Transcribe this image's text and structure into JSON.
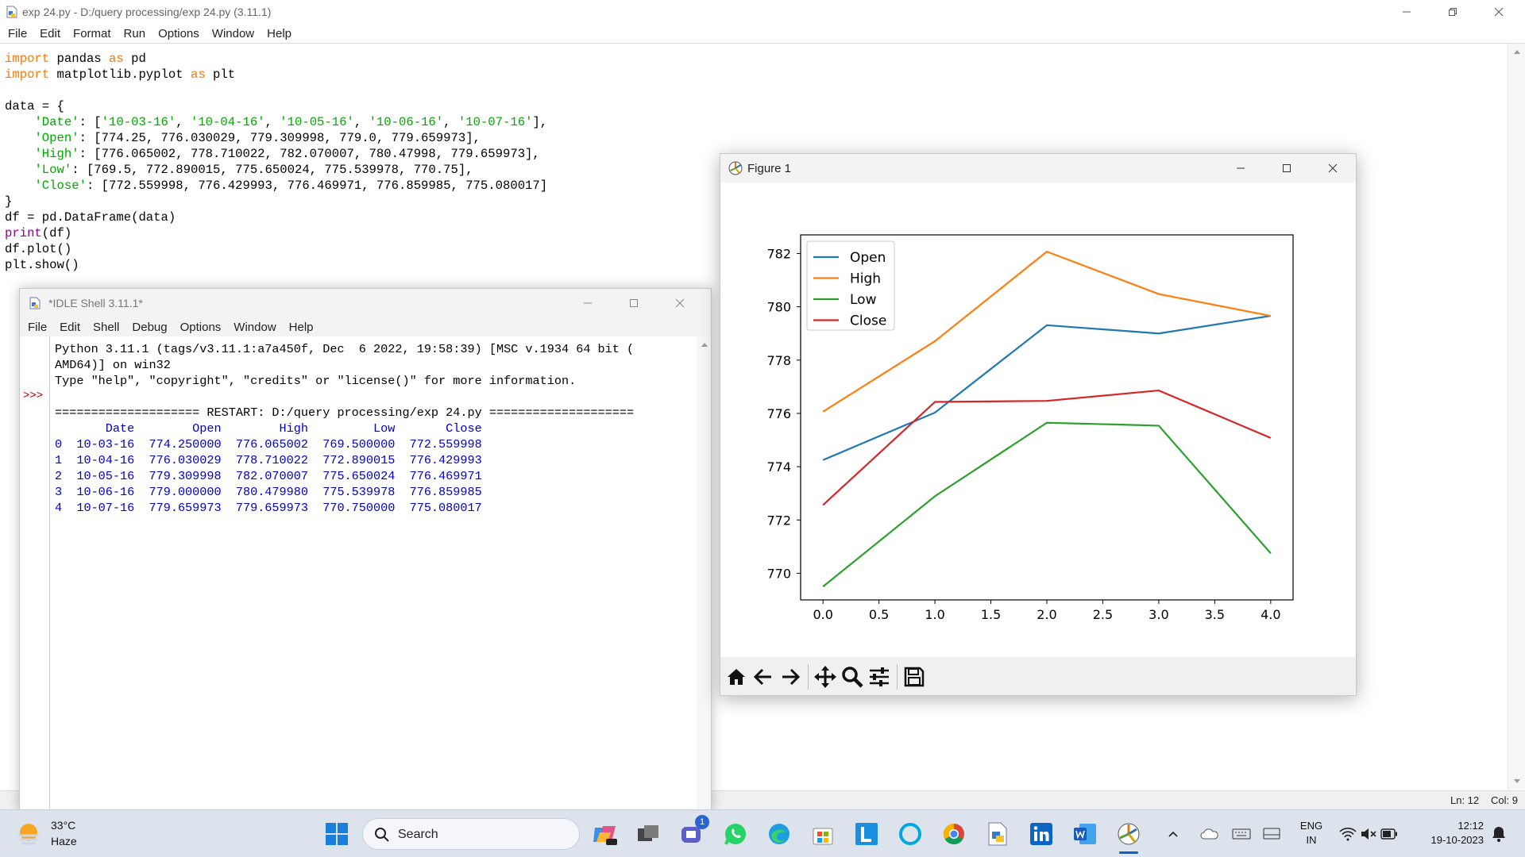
{
  "editor": {
    "title": "exp 24.py - D:/query processing/exp 24.py (3.11.1)",
    "menu": [
      "File",
      "Edit",
      "Format",
      "Run",
      "Options",
      "Window",
      "Help"
    ],
    "status": {
      "line": "Ln: 12",
      "col": "Col: 9"
    }
  },
  "code_lines": [
    [
      [
        "kw",
        "import"
      ],
      [
        "",
        " pandas "
      ],
      [
        "kw",
        "as"
      ],
      [
        "",
        " pd"
      ]
    ],
    [
      [
        "kw",
        "import"
      ],
      [
        "",
        " matplotlib.pyplot "
      ],
      [
        "kw",
        "as"
      ],
      [
        "",
        " plt"
      ]
    ],
    [],
    [
      [
        "",
        "data = {"
      ]
    ],
    [
      [
        "",
        "    "
      ],
      [
        "str",
        "'Date'"
      ],
      [
        "",
        ": ["
      ],
      [
        "str",
        "'10-03-16'"
      ],
      [
        "",
        ", "
      ],
      [
        "str",
        "'10-04-16'"
      ],
      [
        "",
        ", "
      ],
      [
        "str",
        "'10-05-16'"
      ],
      [
        "",
        ", "
      ],
      [
        "str",
        "'10-06-16'"
      ],
      [
        "",
        ", "
      ],
      [
        "str",
        "'10-07-16'"
      ],
      [
        "",
        "],"
      ]
    ],
    [
      [
        "",
        "    "
      ],
      [
        "str",
        "'Open'"
      ],
      [
        "",
        ": [774.25, 776.030029, 779.309998, 779.0, 779.659973],"
      ]
    ],
    [
      [
        "",
        "    "
      ],
      [
        "str",
        "'High'"
      ],
      [
        "",
        ": [776.065002, 778.710022, 782.070007, 780.47998, 779.659973],"
      ]
    ],
    [
      [
        "",
        "    "
      ],
      [
        "str",
        "'Low'"
      ],
      [
        "",
        ": [769.5, 772.890015, 775.650024, 775.539978, 770.75],"
      ]
    ],
    [
      [
        "",
        "    "
      ],
      [
        "str",
        "'Close'"
      ],
      [
        "",
        ": [772.559998, 776.429993, 776.469971, 776.859985, 775.080017]"
      ]
    ],
    [
      [
        "",
        "}"
      ]
    ],
    [
      [
        "",
        "df = pd.DataFrame(data)"
      ]
    ],
    [
      [
        "bi",
        "print"
      ],
      [
        "",
        "(df)"
      ]
    ],
    [
      [
        "",
        "df.plot()"
      ]
    ],
    [
      [
        "",
        "plt.show()"
      ]
    ]
  ],
  "shell": {
    "title": "*IDLE Shell 3.11.1*",
    "menu": [
      "File",
      "Edit",
      "Shell",
      "Debug",
      "Options",
      "Window",
      "Help"
    ],
    "prompt": ">>>",
    "banner": [
      "Python 3.11.1 (tags/v3.11.1:a7a450f, Dec  6 2022, 19:58:39) [MSC v.1934 64 bit (",
      "AMD64)] on win32",
      "Type \"help\", \"copyright\", \"credits\" or \"license()\" for more information."
    ],
    "restart": "==================== RESTART: D:/query processing/exp 24.py ====================",
    "output": [
      "       Date        Open        High         Low       Close",
      "0  10-03-16  774.250000  776.065002  769.500000  772.559998",
      "1  10-04-16  776.030029  778.710022  772.890015  776.429993",
      "2  10-05-16  779.309998  782.070007  775.650024  776.469971",
      "3  10-06-16  779.000000  780.479980  775.539978  776.859985",
      "4  10-07-16  779.659973  779.659973  770.750000  775.080017"
    ]
  },
  "figure": {
    "title": "Figure 1",
    "toolbar": [
      "home-icon",
      "back-arrow-icon",
      "forward-arrow-icon",
      "pan-icon",
      "zoom-icon",
      "configure-subplots-icon",
      "save-icon"
    ]
  },
  "chart_data": {
    "type": "line",
    "x": [
      0,
      1,
      2,
      3,
      4
    ],
    "xticks": [
      "0.0",
      "0.5",
      "1.0",
      "1.5",
      "2.0",
      "2.5",
      "3.0",
      "3.5",
      "4.0"
    ],
    "yticks": [
      "770",
      "772",
      "774",
      "776",
      "778",
      "780",
      "782"
    ],
    "xlim": [
      -0.2,
      4.2
    ],
    "ylim": [
      769.0,
      782.7
    ],
    "legend_position": "upper left",
    "series": [
      {
        "name": "Open",
        "color": "#1f77b4",
        "values": [
          774.25,
          776.030029,
          779.309998,
          779.0,
          779.659973
        ]
      },
      {
        "name": "High",
        "color": "#ff7f0e",
        "values": [
          776.065002,
          778.710022,
          782.070007,
          780.47998,
          779.659973
        ]
      },
      {
        "name": "Low",
        "color": "#2ca02c",
        "values": [
          769.5,
          772.890015,
          775.650024,
          775.539978,
          770.75
        ]
      },
      {
        "name": "Close",
        "color": "#d62728",
        "values": [
          772.559998,
          776.429993,
          776.469971,
          776.859985,
          775.080017
        ]
      }
    ]
  },
  "taskbar": {
    "weather_temp": "33°C",
    "weather_cond": "Haze",
    "search_label": "Search",
    "lang_top": "ENG",
    "lang_bottom": "IN",
    "time": "12:12",
    "date": "19-10-2023",
    "teams_badge": "1"
  }
}
